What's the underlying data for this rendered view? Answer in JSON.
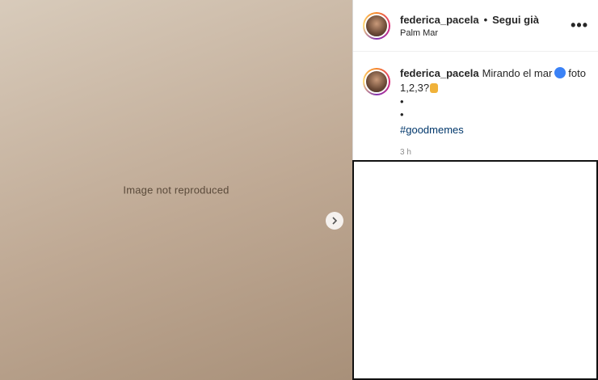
{
  "post": {
    "username": "federica_pacela",
    "separator": "•",
    "follow_status": "Segui già",
    "location": "Palm Mar",
    "more_label": "•••",
    "caption_text_before": "Mirando el mar",
    "caption_text_after": "foto 1,2,3?",
    "bullet_1": "•",
    "bullet_2": "•",
    "hashtag": "#goodmemes",
    "timestamp": "3 h"
  },
  "media": {
    "note": "Image not reproduced",
    "next_icon": "chevron-right-icon"
  },
  "colors": {
    "link": "#00376b",
    "muted": "#8e8e8e",
    "text": "#262626"
  }
}
